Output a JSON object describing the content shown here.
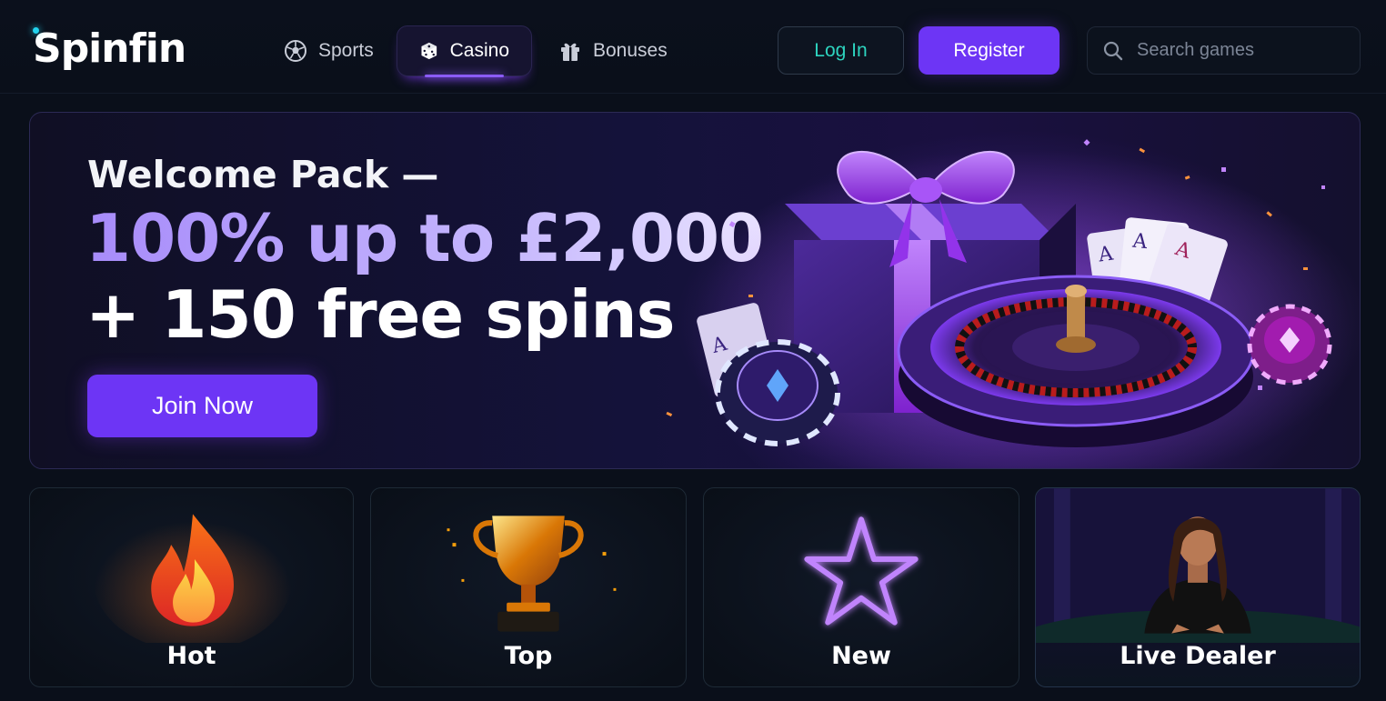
{
  "brand": {
    "name": "Spinfin",
    "accent": "#6d35f5",
    "accent_light": "#a78bfa",
    "teal": "#2dd4bf"
  },
  "nav": {
    "items": [
      {
        "label": "Sports",
        "icon": "soccer-ball-icon",
        "active": false
      },
      {
        "label": "Casino",
        "icon": "dice-icon",
        "active": true
      },
      {
        "label": "Bonuses",
        "icon": "gift-icon",
        "active": false
      }
    ]
  },
  "auth": {
    "login_label": "Log In",
    "register_label": "Register"
  },
  "search": {
    "placeholder": "Search games",
    "icon": "search-icon"
  },
  "hero": {
    "line1": "Welcome Pack —",
    "line2": "100% up to £2,000",
    "line3": "+ 150 free spins",
    "cta_label": "Join Now"
  },
  "categories": [
    {
      "label": "Hot",
      "icon": "flame-icon"
    },
    {
      "label": "Top",
      "icon": "trophy-icon"
    },
    {
      "label": "New",
      "icon": "star-icon"
    },
    {
      "label": "Live Dealer",
      "icon": "dealer-icon"
    }
  ]
}
